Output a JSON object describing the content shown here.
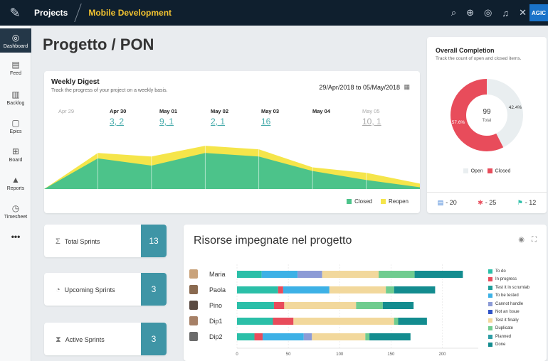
{
  "topbar": {
    "projects": "Projects",
    "current": "Mobile Development",
    "brand": "AGIC"
  },
  "sidebar": {
    "items": [
      {
        "label": "Dashboard",
        "icon": "dashboard-icon"
      },
      {
        "label": "Feed",
        "icon": "feed-icon"
      },
      {
        "label": "Backlog",
        "icon": "backlog-icon"
      },
      {
        "label": "Epics",
        "icon": "epics-icon"
      },
      {
        "label": "Board",
        "icon": "board-icon"
      },
      {
        "label": "Reports",
        "icon": "reports-icon"
      },
      {
        "label": "Timesheet",
        "icon": "timesheet-icon"
      },
      {
        "label": "•••",
        "icon": "more-icon"
      }
    ]
  },
  "page": {
    "title": "Progetto / PON"
  },
  "weekly_digest": {
    "title": "Weekly Digest",
    "subtitle": "Track the progress of your project on a weekly basis.",
    "range": "29/Apr/2018  to  05/May/2018",
    "days": [
      {
        "date": "Apr 29",
        "values": ""
      },
      {
        "date": "Apr 30",
        "values": "3, 2"
      },
      {
        "date": "May 01",
        "values": "9, 1"
      },
      {
        "date": "May 02",
        "values": "2, 1"
      },
      {
        "date": "May 03",
        "values": "16"
      },
      {
        "date": "May 04",
        "values": ""
      },
      {
        "date": "May 05",
        "values": "10, 1"
      }
    ],
    "legend": {
      "closed": "Closed",
      "reopen": "Reopen"
    },
    "colors": {
      "closed": "#4cc38a",
      "reopen": "#f5e54a"
    },
    "chart": {
      "closed": [
        0,
        17,
        13,
        20,
        18,
        10,
        5,
        1
      ],
      "reopen": [
        0,
        20,
        18,
        24,
        22,
        12,
        9,
        3
      ]
    }
  },
  "overall_completion": {
    "title": "Overall Completion",
    "subtitle": "Track the count of open and closed items.",
    "total": "99",
    "total_label": "Total",
    "open_pct": "42.4%",
    "closed_pct": "57.6%",
    "legend_open": "Open",
    "legend_closed": "Closed",
    "open_value": 42.4,
    "closed_value": 57.6,
    "colors": {
      "open": "#e9eef0",
      "closed": "#e84c5b"
    },
    "stats": [
      {
        "icon": "list-icon",
        "value": "- 20"
      },
      {
        "icon": "bug-icon",
        "value": "- 25"
      },
      {
        "icon": "flag-icon",
        "value": "- 12"
      }
    ]
  },
  "sprints": [
    {
      "label": "Total Sprints",
      "count": "13",
      "icon": "sigma-icon"
    },
    {
      "label": "Upcoming Sprints",
      "count": "3",
      "icon": "clock-icon"
    },
    {
      "label": "Active Sprints",
      "count": "3",
      "icon": "hourglass-icon"
    }
  ],
  "risorse": {
    "title": "Risorse impegnate nel progetto",
    "people": [
      "Maria",
      "Paola",
      "Pino",
      "Dip1",
      "Dip2"
    ],
    "legend": [
      "To do",
      "In progress",
      "Test it in scrumlab",
      "To be tested",
      "Cannot handle",
      "Not an Issue",
      "Test it finally",
      "Duplicate",
      "Planned",
      "Done"
    ],
    "legend_colors": [
      "#2bbfa8",
      "#e84c5b",
      "#1f9e9a",
      "#3db1e6",
      "#8c9bd6",
      "#3155c7",
      "#f2d89c",
      "#6fcc8f",
      "#2f9ea6",
      "#138c8f"
    ],
    "x_ticks": [
      "0",
      "50",
      "100",
      "150",
      "200"
    ]
  },
  "chart_data": {
    "type": "bar",
    "orientation": "horizontal",
    "stacked": true,
    "title": "Risorse impegnate nel progetto",
    "categories": [
      "Maria",
      "Paola",
      "Pino",
      "Dip1",
      "Dip2"
    ],
    "xlim": [
      0,
      235
    ],
    "series": [
      {
        "name": "To do",
        "values": [
          24,
          40,
          36,
          35,
          17
        ]
      },
      {
        "name": "In progress",
        "values": [
          0,
          5,
          10,
          20,
          8
        ]
      },
      {
        "name": "To be tested",
        "values": [
          35,
          45,
          0,
          0,
          40
        ]
      },
      {
        "name": "Cannot handle",
        "values": [
          24,
          0,
          0,
          0,
          8
        ]
      },
      {
        "name": "Test it finally",
        "values": [
          55,
          55,
          70,
          98,
          52
        ]
      },
      {
        "name": "Duplicate",
        "values": [
          35,
          8,
          26,
          4,
          4
        ]
      },
      {
        "name": "Done",
        "values": [
          47,
          40,
          30,
          28,
          40
        ]
      }
    ]
  }
}
